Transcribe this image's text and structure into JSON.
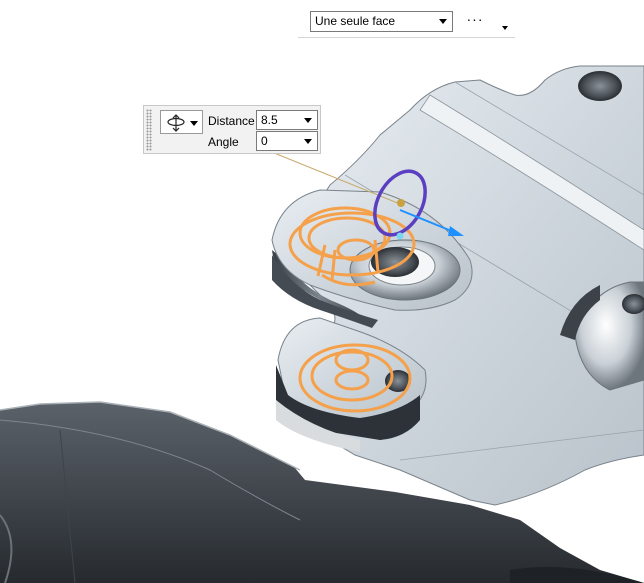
{
  "toolbar": {
    "selection_filter": "Une seule face",
    "more_label": "···"
  },
  "editor": {
    "handle_icon": "move-handle-icon",
    "distance_label": "Distance",
    "distance_value": "8.5",
    "angle_label": "Angle",
    "angle_value": "0"
  },
  "colors": {
    "selection": "#f5a04a",
    "rotation_ring": "#5a3fc0",
    "axis_arrow": "#1e90ff",
    "part_dark": "#2c3036"
  }
}
